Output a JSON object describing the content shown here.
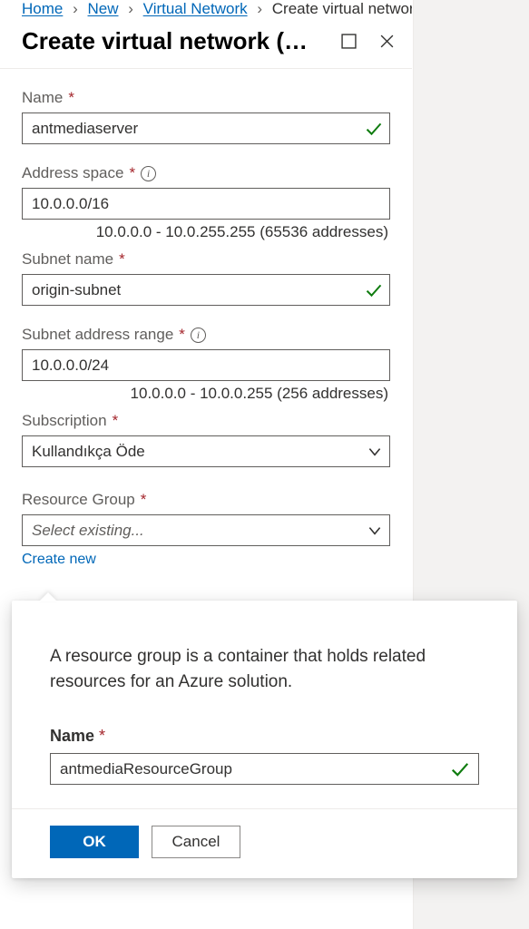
{
  "breadcrumbs": {
    "home": "Home",
    "new": "New",
    "vnet": "Virtual Network",
    "current": "Create virtual network (classi"
  },
  "blade": {
    "title": "Create virtual network (cl…"
  },
  "form": {
    "name_label": "Name",
    "name_value": "antmediaserver",
    "address_space_label": "Address space",
    "address_space_value": "10.0.0.0/16",
    "address_space_hint": "10.0.0.0 - 10.0.255.255 (65536 addresses)",
    "subnet_name_label": "Subnet name",
    "subnet_name_value": "origin-subnet",
    "subnet_range_label": "Subnet address range",
    "subnet_range_value": "10.0.0.0/24",
    "subnet_range_hint": "10.0.0.0 - 10.0.0.255 (256 addresses)",
    "subscription_label": "Subscription",
    "subscription_value": "Kullandıkça Öde",
    "rg_label": "Resource Group",
    "rg_placeholder": "Select existing...",
    "create_new": "Create new"
  },
  "popover": {
    "desc": "A resource group is a container that holds related resources for an Azure solution.",
    "name_label": "Name",
    "name_value": "antmediaResourceGroup",
    "ok": "OK",
    "cancel": "Cancel"
  }
}
